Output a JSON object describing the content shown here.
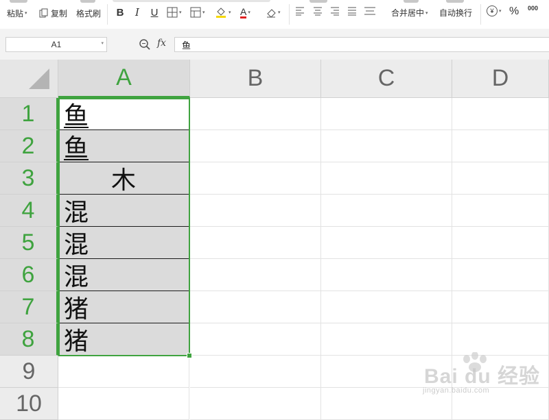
{
  "toolbar": {
    "paste": "粘贴",
    "copy": "复制",
    "format_painter": "格式刷",
    "bold": "B",
    "italic": "I",
    "underline": "U",
    "font_color_letter": "A",
    "merge_center": "合并居中",
    "wrap_text": "自动换行",
    "currency_symbol": "¥",
    "percent": "%",
    "thousands": "000"
  },
  "formula_bar": {
    "name_box": "A1",
    "fx": "fx",
    "content": "鱼"
  },
  "grid": {
    "columns": [
      "A",
      "B",
      "C",
      "D"
    ],
    "rows": [
      "1",
      "2",
      "3",
      "4",
      "5",
      "6",
      "7",
      "8",
      "9",
      "10"
    ],
    "column_A_values": [
      "鱼",
      "鱼",
      "木",
      "混",
      "混",
      "混",
      "猪",
      "猪"
    ]
  },
  "watermark": {
    "brand": "Bai du 经验",
    "url": "jingyan.baidu.com"
  },
  "colors": {
    "selection": "#3fa33f",
    "header_bg": "#ececec",
    "selected_fill": "#dbdbdb"
  }
}
